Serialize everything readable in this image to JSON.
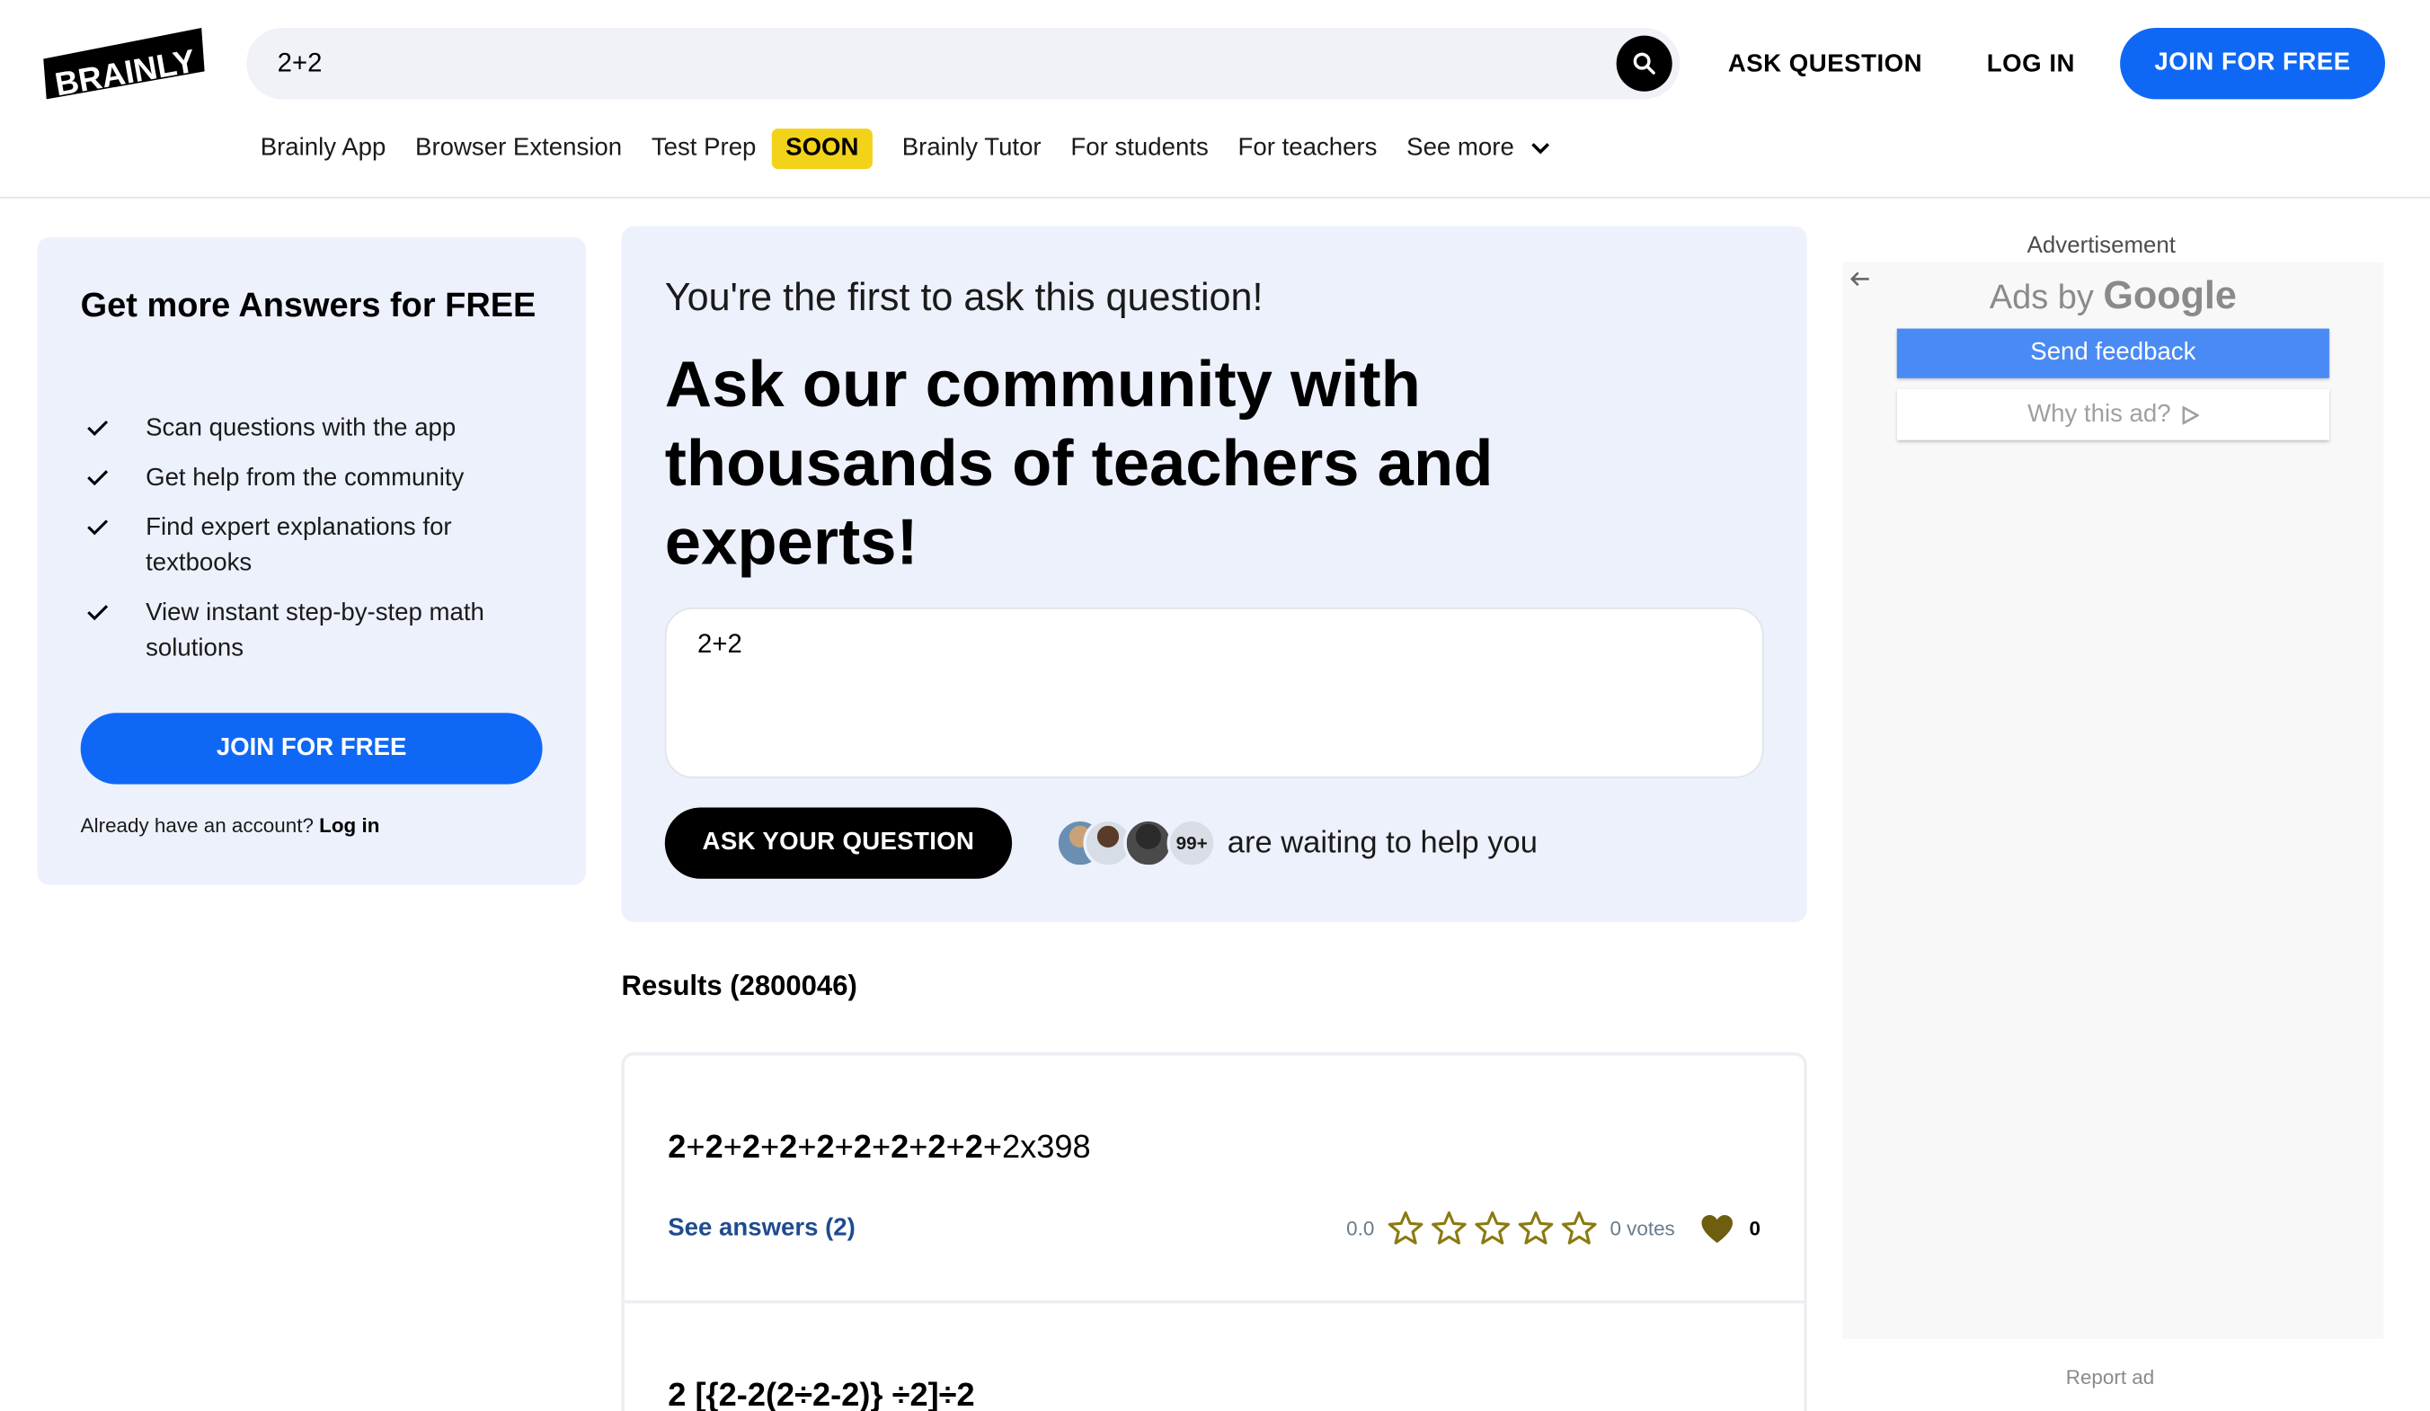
{
  "header": {
    "logo_text": "BRAINLY",
    "search_value": "2+2",
    "ask_question": "ASK QUESTION",
    "log_in": "LOG IN",
    "join": "JOIN FOR FREE"
  },
  "nav": {
    "items": [
      "Brainly App",
      "Browser Extension",
      "Test Prep"
    ],
    "soon_badge": "SOON",
    "items2": [
      "Brainly Tutor",
      "For students",
      "For teachers"
    ],
    "see_more": "See more"
  },
  "left_panel": {
    "title": "Get more Answers for FREE",
    "features": [
      "Scan questions with the app",
      "Get help from the community",
      "Find expert explanations for textbooks",
      "View instant step-by-step math solutions"
    ],
    "join": "JOIN FOR FREE",
    "account_prompt": "Already have an account?",
    "login_link": "Log in"
  },
  "ask": {
    "first": "You're the first to ask this question!",
    "headline": "Ask our community with thousands of teachers and experts!",
    "input_value": "2+2",
    "button": "ASK YOUR QUESTION",
    "helpers_count": "99+",
    "waiting": "are waiting to help you"
  },
  "results": {
    "title": "Results (2800046)",
    "items": [
      {
        "question_parts": [
          "2",
          "+",
          "2",
          "+",
          "2",
          "+",
          "2",
          "+",
          "2",
          "+",
          "2",
          "+",
          "2",
          "+",
          "2",
          "+",
          "2",
          "+2x398"
        ],
        "see_answers": "See answers (2)",
        "rating": "0.0",
        "votes": "0 votes",
        "likes": "0",
        "stars": 0
      },
      {
        "question_text": "2 [{2-2(2÷2-2)} ÷2]÷2"
      }
    ]
  },
  "ad": {
    "label": "Advertisement",
    "ads_by": "Ads by",
    "google": "Google",
    "send_feedback": "Send feedback",
    "why_ad": "Why this ad?",
    "report": "Report ad"
  },
  "colors": {
    "brand_blue": "#0f68f5",
    "panel_bg": "#edf1fc",
    "soon_yellow": "#f3d21a",
    "star_gold": "#8a7a10"
  }
}
